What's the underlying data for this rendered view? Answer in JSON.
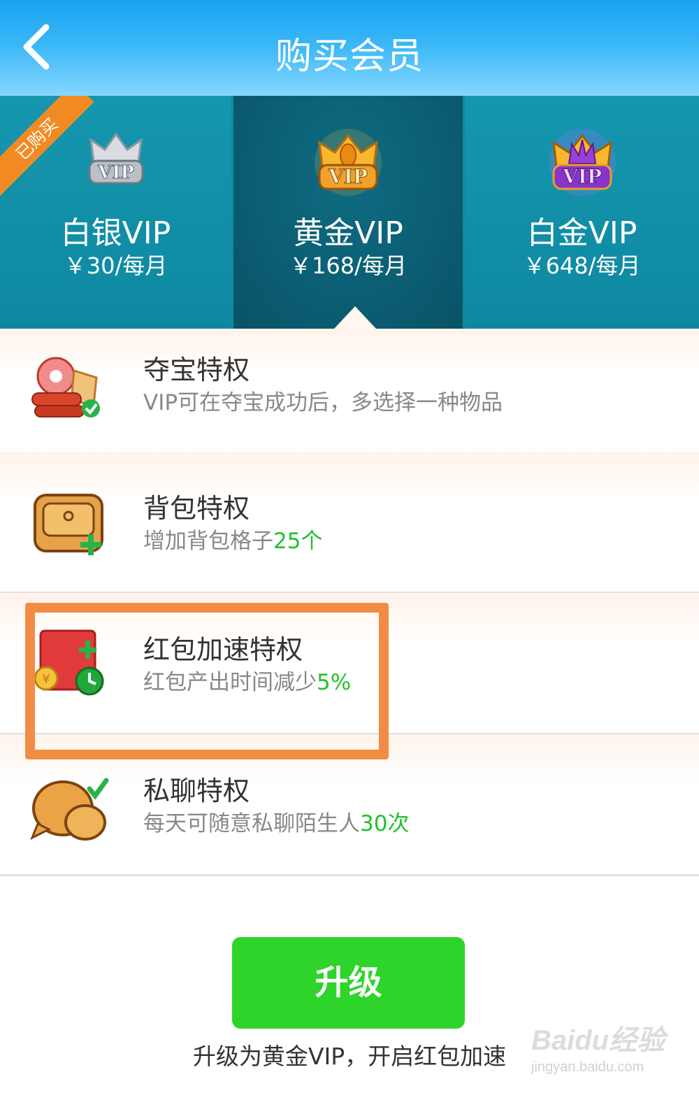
{
  "header": {
    "title": "购买会员"
  },
  "tiers": [
    {
      "name": "白银VIP",
      "price": "￥30/每月",
      "badge": "已购买",
      "selected": false
    },
    {
      "name": "黄金VIP",
      "price": "￥168/每月",
      "selected": true
    },
    {
      "name": "白金VIP",
      "price": "￥648/每月",
      "selected": false
    }
  ],
  "privileges": [
    {
      "title": "夺宝特权",
      "desc": "VIP可在夺宝成功后，多选择一种物品",
      "highlight": ""
    },
    {
      "title": "背包特权",
      "desc": "增加背包格子",
      "highlight": "25个"
    },
    {
      "title": "红包加速特权",
      "desc": "红包产出时间减少",
      "highlight": "5%"
    },
    {
      "title": "私聊特权",
      "desc": "每天可随意私聊陌生人",
      "highlight": "30次"
    }
  ],
  "upgrade": {
    "button_label": "升级",
    "note": "升级为黄金VIP，开启红包加速"
  },
  "watermark": {
    "logo": "Baidu经验",
    "url": "jingyan.baidu.com"
  },
  "colors": {
    "header": "#38b6f6",
    "tier_bg": "#1597ae",
    "tier_selected_bg": "#0b5d72",
    "accent_green": "#22c22a",
    "button_green": "#2fd42a",
    "highlight_box": "#f28c45",
    "ribbon": "#f28a23"
  }
}
